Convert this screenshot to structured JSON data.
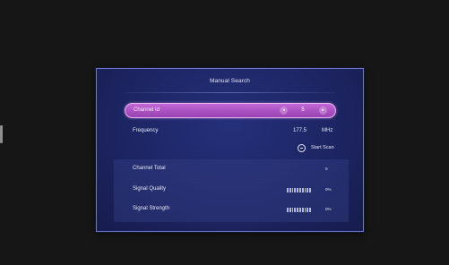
{
  "dialog": {
    "title": "Manual Search"
  },
  "channel": {
    "label": "Channel Id",
    "value": "5",
    "left_arrow": "◂",
    "right_arrow": "▸"
  },
  "frequency": {
    "label": "Frequency",
    "value": "177.5",
    "unit": "MHz"
  },
  "scan": {
    "label": "Start Scan",
    "icon": "minus-circle-icon"
  },
  "info": {
    "channel_total": {
      "label": "Channel Total",
      "value": "0"
    },
    "signal_quality": {
      "label": "Signal Quality",
      "value": "0%",
      "level": 0
    },
    "signal_strength": {
      "label": "Signal Strength",
      "value": "0%",
      "level": 0
    }
  },
  "colors": {
    "dialog_bg": "#1d2563",
    "highlight": "#b25ac8",
    "border": "#6b76c6"
  }
}
